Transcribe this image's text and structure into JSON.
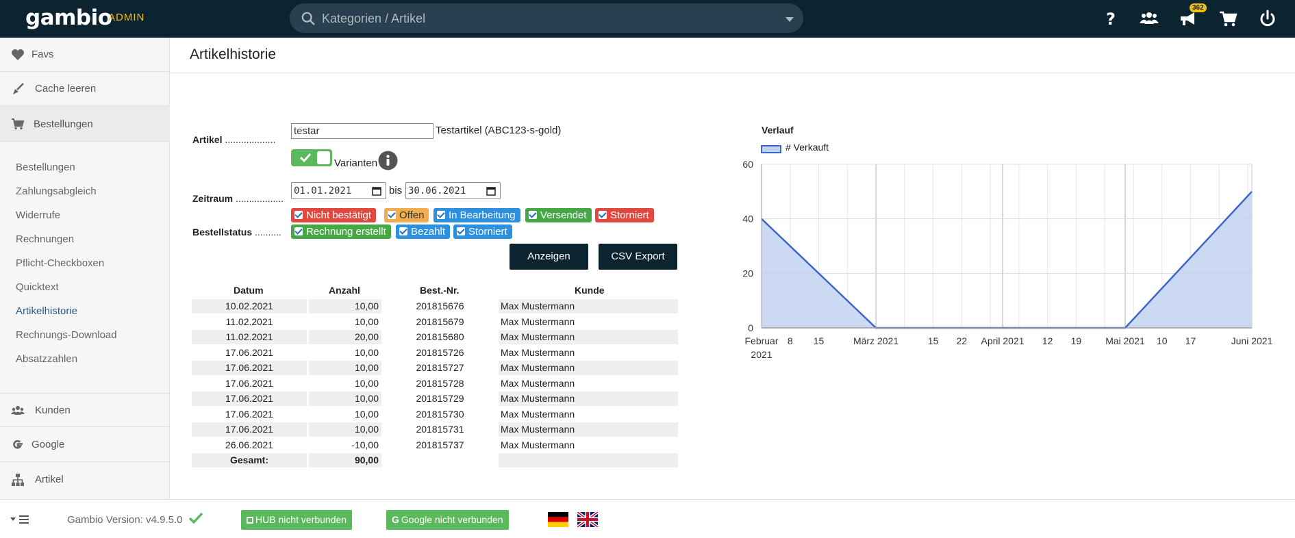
{
  "header": {
    "logo": "gambio",
    "admin": "ADMIN",
    "search_placeholder": "Kategorien / Artikel",
    "notification_count": "362"
  },
  "sidebar": {
    "main_top": [
      {
        "label": "Favs",
        "icon": "heart-icon"
      },
      {
        "label": "Cache leeren",
        "icon": "broom-icon"
      },
      {
        "label": "Bestellungen",
        "icon": "cart-icon"
      }
    ],
    "sub_items": [
      "Bestellungen",
      "Zahlungsabgleich",
      "Widerrufe",
      "Rechnungen",
      "Pflicht-Checkboxen",
      "Quicktext",
      "Artikelhistorie",
      "Rechnungs-Download",
      "Absatzzahlen"
    ],
    "main_bottom": [
      {
        "label": "Kunden",
        "icon": "users-icon"
      },
      {
        "label": "Google",
        "icon": "google-icon"
      },
      {
        "label": "Artikel",
        "icon": "sitemap-icon"
      }
    ]
  },
  "page": {
    "title": "Artikelhistorie"
  },
  "form": {
    "artikel_label": "Artikel",
    "artikel_dots": "...................",
    "artikel_value": "testar",
    "artikel_desc": "Testartikel (ABC123-s-gold)",
    "varianten_label": "Varianten",
    "zeitraum_label": "Zeitraum",
    "zeitraum_dots": "..................",
    "date_from": "01.01.2021",
    "bis": "bis",
    "date_to": "30.06.2021",
    "status_label": "Bestellstatus",
    "status_dots": "..........",
    "status_row1": [
      {
        "label": "Nicht bestätigt",
        "color": "#e2483e"
      },
      {
        "label": "Offen",
        "color": "#f0ad4e"
      },
      {
        "label": "In Bearbeitung",
        "color": "#2d8fe0"
      },
      {
        "label": "Versendet",
        "color": "#45a845"
      },
      {
        "label": "Storniert",
        "color": "#e2483e"
      }
    ],
    "status_row2": [
      {
        "label": "Rechnung erstellt",
        "color": "#45a845"
      },
      {
        "label": "Bezahlt",
        "color": "#2d8fe0"
      },
      {
        "label": "Storniert",
        "color": "#2d8fe0"
      }
    ],
    "btn_show": "Anzeigen",
    "btn_csv": "CSV Export"
  },
  "table": {
    "headers": [
      "Datum",
      "Anzahl",
      "Best.-Nr.",
      "Kunde"
    ],
    "rows": [
      [
        "10.02.2021",
        "10,00",
        "201815676",
        "Max Mustermann"
      ],
      [
        "11.02.2021",
        "10,00",
        "201815679",
        "Max Mustermann"
      ],
      [
        "11.02.2021",
        "20,00",
        "201815680",
        "Max Mustermann"
      ],
      [
        "17.06.2021",
        "10,00",
        "201815726",
        "Max Mustermann"
      ],
      [
        "17.06.2021",
        "10,00",
        "201815727",
        "Max Mustermann"
      ],
      [
        "17.06.2021",
        "10,00",
        "201815728",
        "Max Mustermann"
      ],
      [
        "17.06.2021",
        "10,00",
        "201815729",
        "Max Mustermann"
      ],
      [
        "17.06.2021",
        "10,00",
        "201815730",
        "Max Mustermann"
      ],
      [
        "17.06.2021",
        "10,00",
        "201815731",
        "Max Mustermann"
      ],
      [
        "26.06.2021",
        "-10,00",
        "201815737",
        "Max Mustermann"
      ]
    ],
    "total_label": "Gesamt:",
    "total_value": "90,00"
  },
  "chart_data": {
    "type": "area",
    "title": "Verlauf",
    "legend": "# Verkauft",
    "legend_position": "top-left",
    "color": "#3a66c8",
    "fill": "#c3d2f1",
    "grid": true,
    "ylim": [
      0,
      60
    ],
    "y_ticks": [
      0,
      20,
      40,
      60
    ],
    "xlim": [
      "2021-02-01",
      "2021-06-01"
    ],
    "x_ticks": [
      {
        "date": "2021-02-01",
        "label": "Februar",
        "label2": "2021"
      },
      {
        "date": "2021-02-08",
        "label": "8"
      },
      {
        "date": "2021-02-15",
        "label": "15"
      },
      {
        "date": "2021-03-01",
        "label": "März 2021"
      },
      {
        "date": "2021-03-15",
        "label": "15"
      },
      {
        "date": "2021-03-22",
        "label": "22"
      },
      {
        "date": "2021-04-01",
        "label": "April 2021"
      },
      {
        "date": "2021-04-12",
        "label": "12"
      },
      {
        "date": "2021-04-19",
        "label": "19"
      },
      {
        "date": "2021-05-01",
        "label": "Mai 2021"
      },
      {
        "date": "2021-05-10",
        "label": "10"
      },
      {
        "date": "2021-05-17",
        "label": "17"
      },
      {
        "date": "2021-06-01",
        "label": "Juni 2021"
      }
    ],
    "series": [
      {
        "name": "# Verkauft",
        "x": [
          "2021-02-01",
          "2021-03-01",
          "2021-05-01",
          "2021-06-01"
        ],
        "y": [
          40,
          0,
          0,
          50
        ]
      }
    ]
  },
  "footer": {
    "version": "Gambio Version: v4.9.5.0",
    "hub": "HUB nicht verbunden",
    "google": "Google nicht verbunden"
  }
}
